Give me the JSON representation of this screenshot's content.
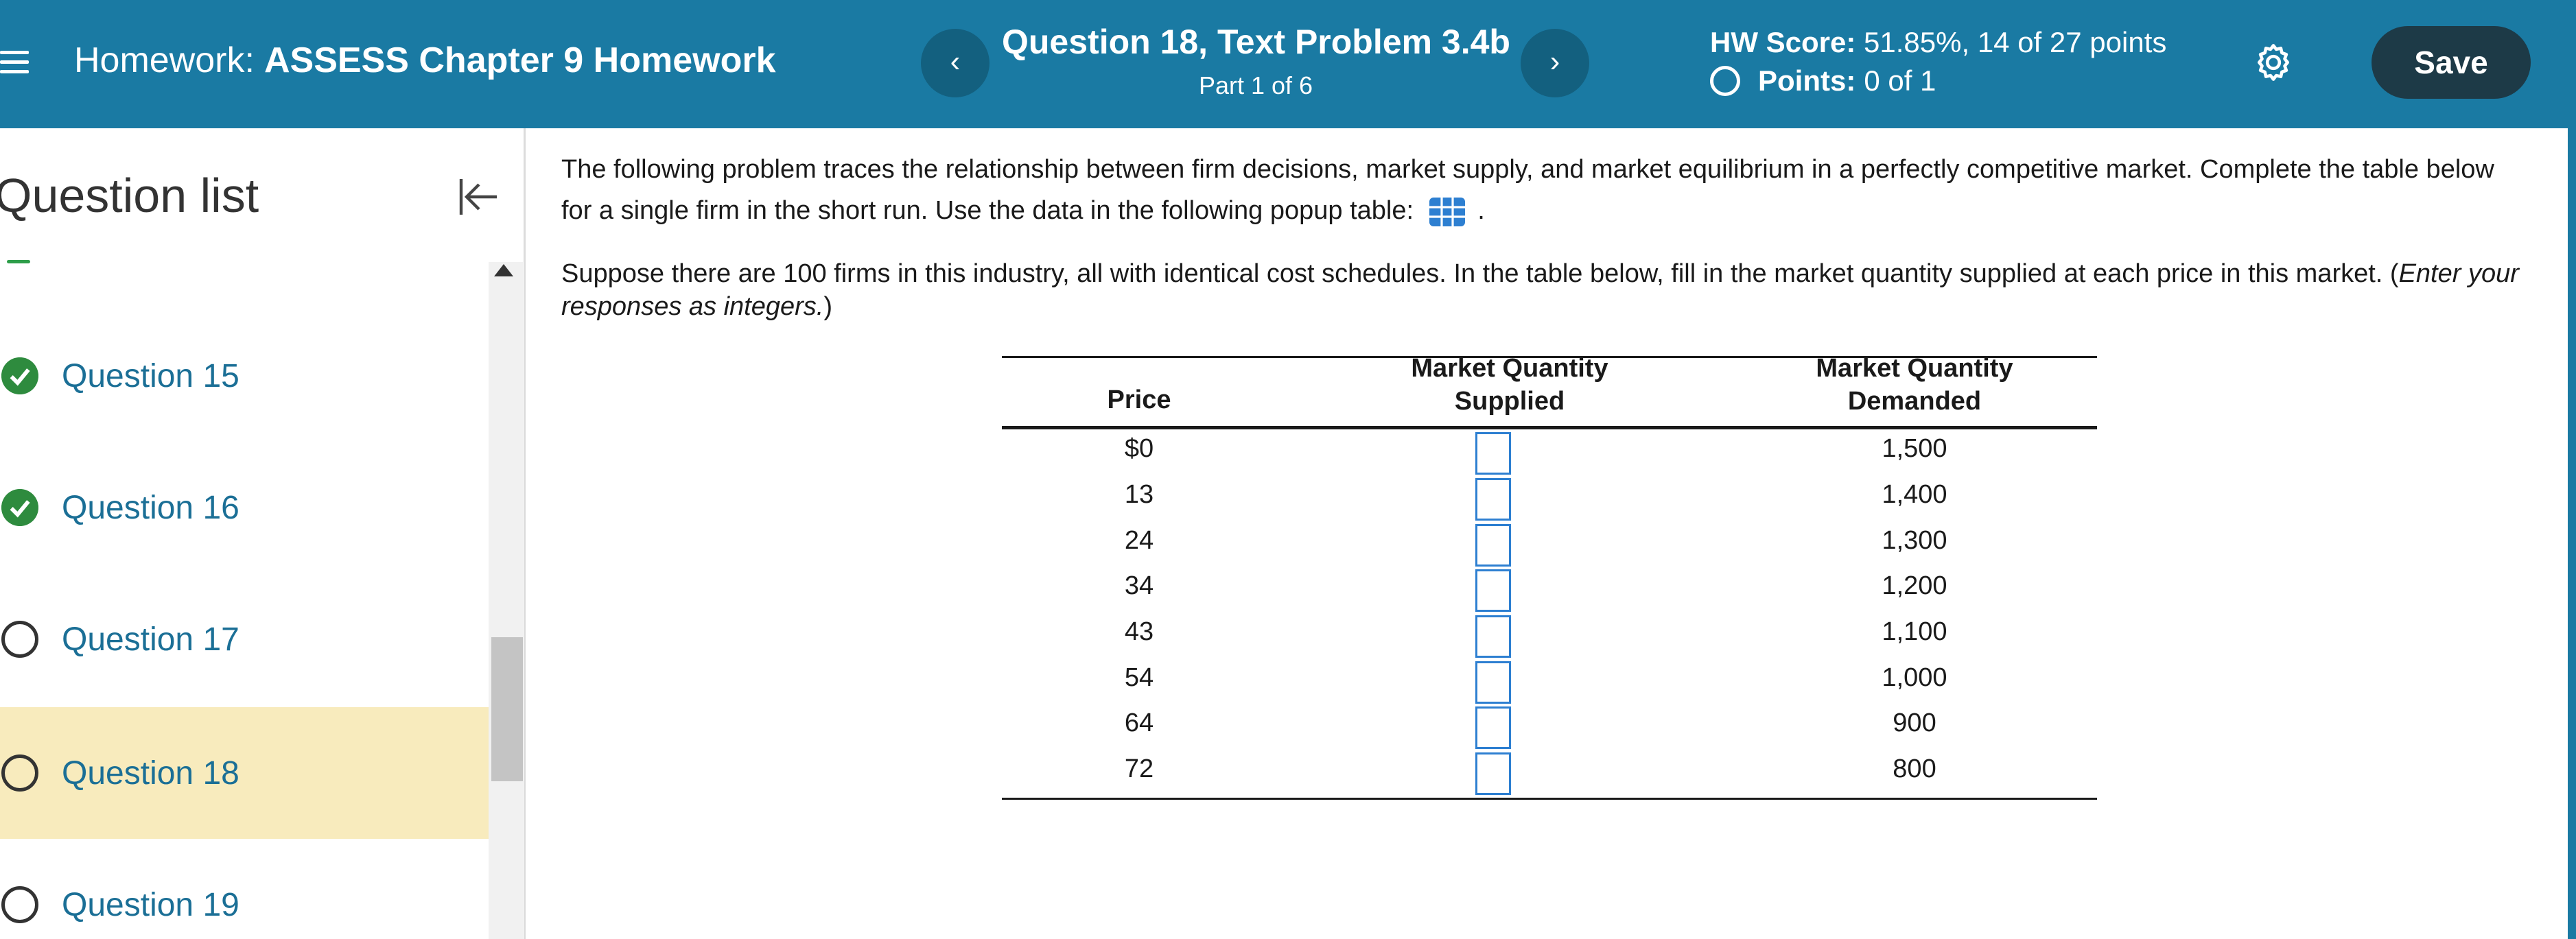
{
  "header": {
    "homework_prefix": "Homework:",
    "homework_name": "ASSESS Chapter 9 Homework",
    "prev_label": "‹",
    "next_label": "›",
    "question_title": "Question 18, Text Problem 3.4b",
    "part_label": "Part 1 of 6",
    "hw_score_label": "HW Score:",
    "hw_score_value": "51.85%, 14 of 27 points",
    "points_label": "Points:",
    "points_value": "0 of 1",
    "save_label": "Save",
    "icons": {
      "menu": "hamburger-icon",
      "settings": "gear-icon",
      "points_status": "open-circle-icon"
    },
    "colors": {
      "header_bg": "#1a7aa3",
      "save_bg": "#1d3a47",
      "nav_btn_bg": "#13607f"
    }
  },
  "sidebar": {
    "title": "Question list",
    "collapse_icon": "collapse-left-icon",
    "items": [
      {
        "label": "Question 15",
        "status": "complete"
      },
      {
        "label": "Question 16",
        "status": "complete"
      },
      {
        "label": "Question 17",
        "status": "incomplete"
      },
      {
        "label": "Question 18",
        "status": "incomplete",
        "active": true
      },
      {
        "label": "Question 19",
        "status": "incomplete"
      }
    ],
    "colors": {
      "active_bg": "#f8ebbd",
      "link": "#1b6f96",
      "complete": "#2e8b3e"
    }
  },
  "problem": {
    "intro_text": "The following problem traces the relationship between firm decisions, market supply, and market equilibrium in a perfectly competitive market. Complete the table below for a single firm in the short run. Use the data in the following popup table:",
    "intro_end": ".",
    "popup_icon": "table-grid-icon",
    "instruction_text": "Suppose there are 100 firms in this industry, all with identical cost schedules. In the table below, fill in the market quantity supplied at each price in this market. (",
    "instruction_italic": "Enter your responses as integers.",
    "instruction_close": ")"
  },
  "table": {
    "headers": {
      "price": "Price",
      "supplied_line1": "Market Quantity",
      "supplied_line2": "Supplied",
      "demanded_line1": "Market Quantity",
      "demanded_line2": "Demanded"
    },
    "rows": [
      {
        "price": "$0",
        "supplied": "",
        "demanded": "1,500"
      },
      {
        "price": "13",
        "supplied": "",
        "demanded": "1,400"
      },
      {
        "price": "24",
        "supplied": "",
        "demanded": "1,300"
      },
      {
        "price": "34",
        "supplied": "",
        "demanded": "1,200"
      },
      {
        "price": "43",
        "supplied": "",
        "demanded": "1,100"
      },
      {
        "price": "54",
        "supplied": "",
        "demanded": "1,000"
      },
      {
        "price": "64",
        "supplied": "",
        "demanded": "900"
      },
      {
        "price": "72",
        "supplied": "",
        "demanded": "800"
      }
    ]
  }
}
